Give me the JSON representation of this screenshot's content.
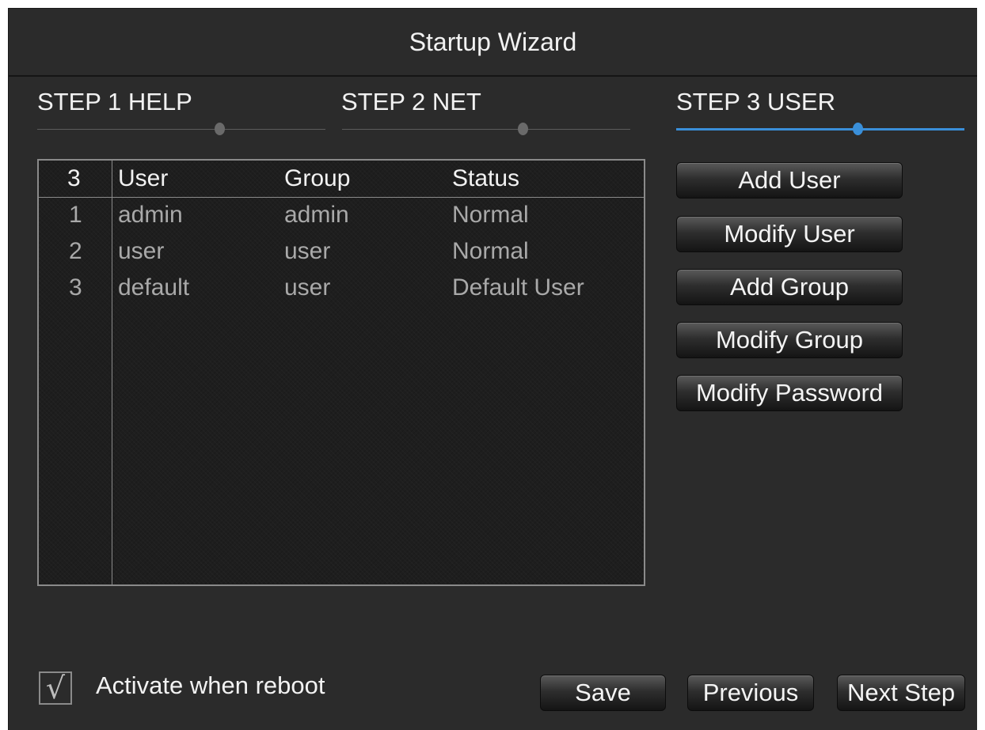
{
  "window": {
    "title": "Startup Wizard"
  },
  "steps": [
    {
      "label": "STEP 1 HELP",
      "active": false
    },
    {
      "label": "STEP 2 NET",
      "active": false
    },
    {
      "label": "STEP 3 USER",
      "active": true
    }
  ],
  "colors": {
    "accent": "#3a8fd9",
    "background": "#2b2b2b"
  },
  "user_table": {
    "headers": [
      "3",
      "User",
      "Group",
      "Status"
    ],
    "rows": [
      [
        "1",
        "admin",
        "admin",
        "Normal"
      ],
      [
        "2",
        "user",
        "user",
        "Normal"
      ],
      [
        "3",
        "default",
        "user",
        "Default User"
      ]
    ]
  },
  "side_buttons": {
    "add_user": "Add User",
    "modify_user": "Modify User",
    "add_group": "Add Group",
    "modify_group": "Modify Group",
    "modify_password": "Modify Password"
  },
  "footer": {
    "activate_label": "Activate when reboot",
    "activate_checked": true,
    "check_glyph": "√",
    "save": "Save",
    "previous": "Previous",
    "next_step": "Next Step"
  }
}
